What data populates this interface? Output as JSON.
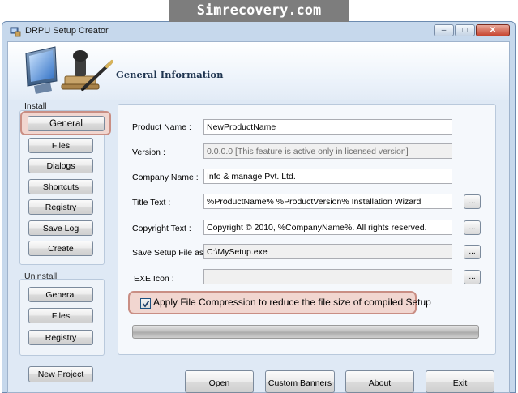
{
  "banner": {
    "text": "Simrecovery.com"
  },
  "window": {
    "title": "DRPU Setup Creator",
    "minimize_glyph": "‒",
    "maximize_glyph": "□",
    "close_glyph": "✕"
  },
  "header": {
    "title": "General Information"
  },
  "install": {
    "label": "Install",
    "buttons": [
      "General",
      "Files",
      "Dialogs",
      "Shortcuts",
      "Registry",
      "Save Log",
      "Create"
    ]
  },
  "uninstall": {
    "label": "Uninstall",
    "buttons": [
      "General",
      "Files",
      "Registry"
    ]
  },
  "new_project": "New Project",
  "form": {
    "product_name": {
      "label": "Product Name :",
      "value": "NewProductName"
    },
    "version": {
      "label": "Version :",
      "value": "0.0.0.0 [This feature is active only in licensed version]"
    },
    "company_name": {
      "label": "Company Name :",
      "value": "Info & manage Pvt. Ltd."
    },
    "title_text": {
      "label": "Title Text :",
      "value": "%ProductName% %ProductVersion% Installation Wizard"
    },
    "copyright_text": {
      "label": "Copyright Text :",
      "value": "Copyright © 2010, %CompanyName%. All rights reserved."
    },
    "save_setup": {
      "label": "Save Setup File as :",
      "value": "C:\\MySetup.exe"
    },
    "exe_icon": {
      "label": "EXE Icon :",
      "value": ""
    },
    "browse_label": "..."
  },
  "compression": {
    "label": "Apply File Compression to reduce the file size of compiled Setup",
    "checked": true
  },
  "progress": {
    "value": 0
  },
  "bottom_buttons": {
    "open": "Open",
    "custom_banners": "Custom Banners",
    "about": "About",
    "exit": "Exit"
  },
  "icons": [
    "drpu-app-icon",
    "monitor-stamp-pen-art"
  ],
  "colors": {
    "window_bg": "#c6d8ec",
    "client_bg": "#dfe9f5",
    "highlight": "#f1d6d0",
    "highlight_border": "#c98e84",
    "header_title": "#1f3550"
  }
}
